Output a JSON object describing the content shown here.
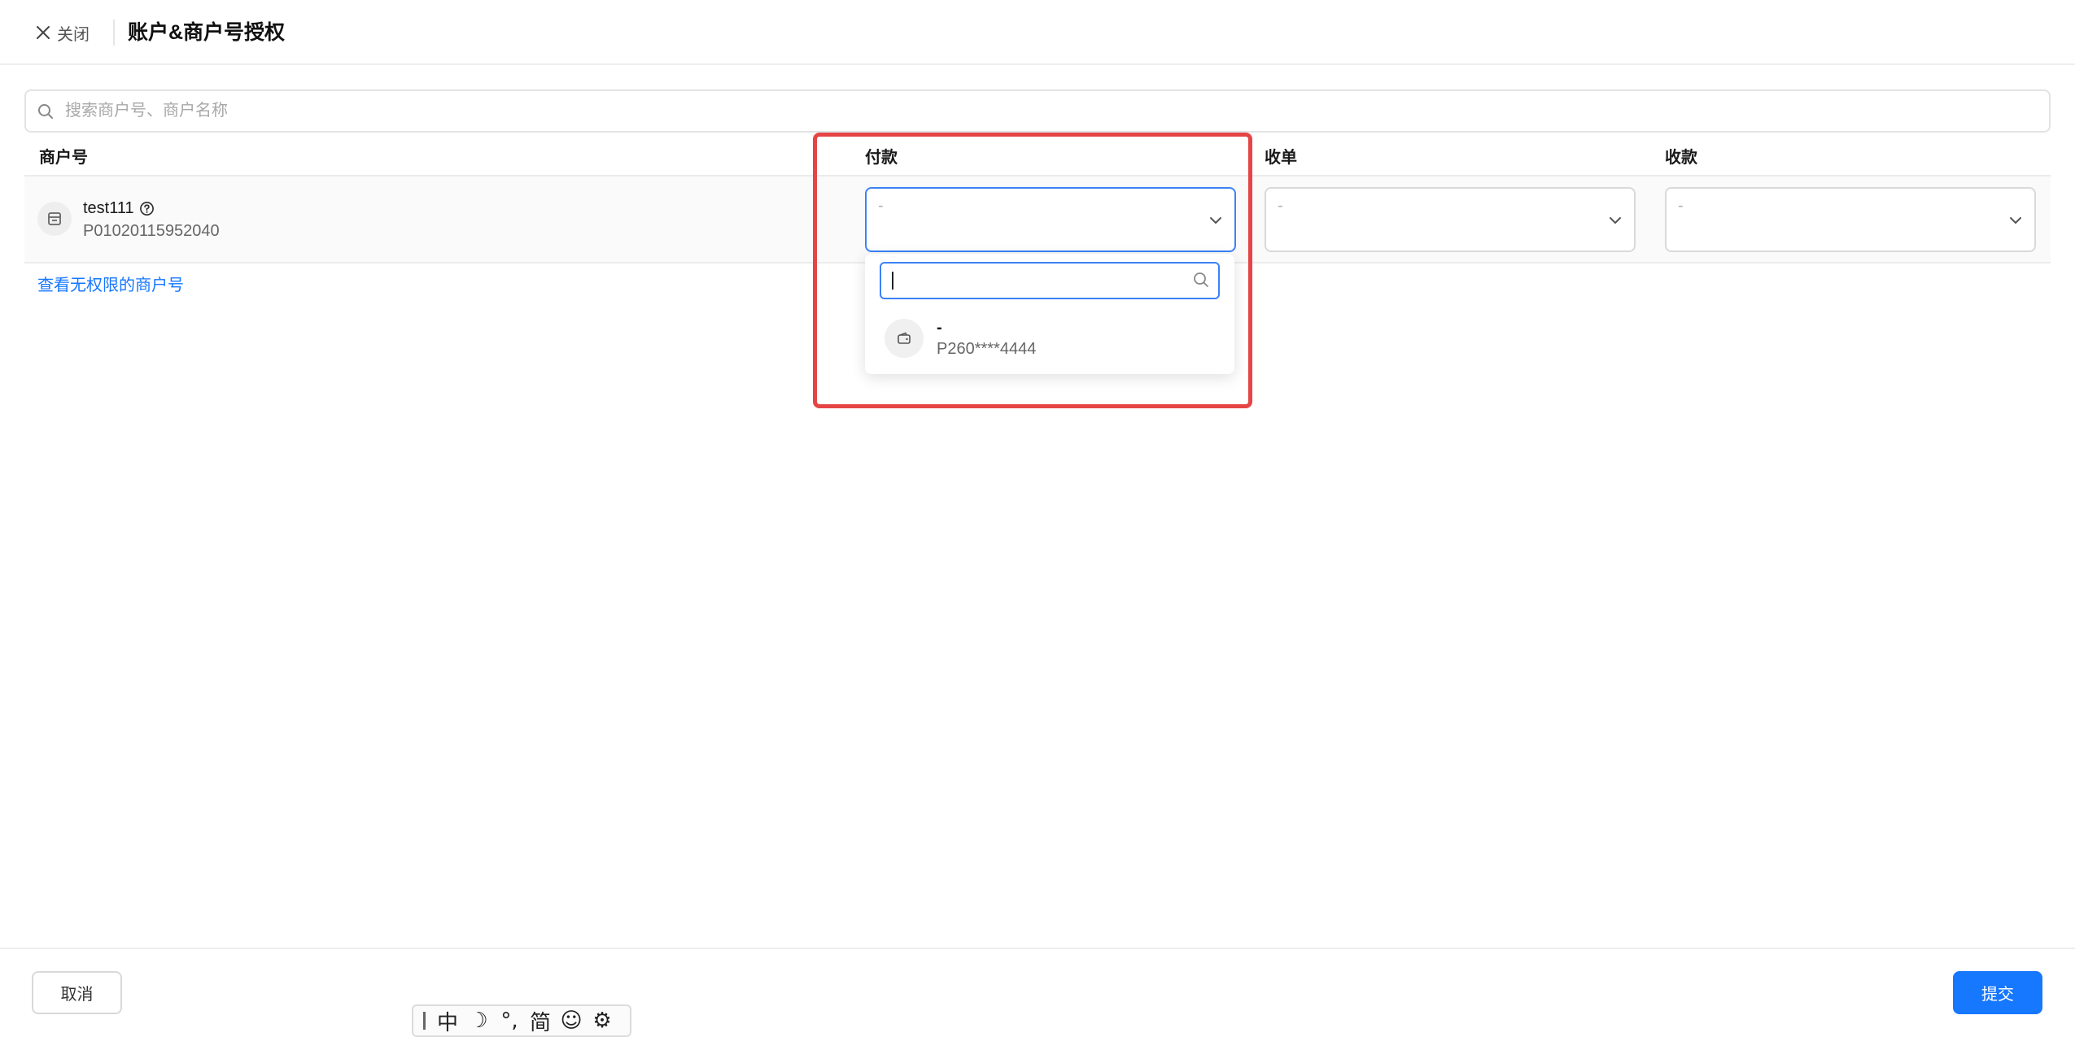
{
  "header": {
    "close_label": "关闭",
    "title": "账户&商户号授权"
  },
  "search": {
    "placeholder": "搜索商户号、商户名称"
  },
  "table": {
    "columns": [
      "商户号",
      "付款",
      "收单",
      "收款"
    ],
    "row": {
      "name": "test111",
      "merchant_id": "P01020115952040",
      "pay_value": "-",
      "acquire_value": "-",
      "receive_value": "-"
    }
  },
  "link": {
    "unlimited": "查看无权限的商户号"
  },
  "dropdown": {
    "search_value": "",
    "option": {
      "name": "-",
      "account": "P260****4444"
    }
  },
  "footer": {
    "cancel_label": "取消",
    "submit_label": "提交"
  },
  "ime": {
    "buttons": [
      "中",
      "☽",
      "°,",
      "简",
      "☺",
      "⚙"
    ]
  },
  "colors": {
    "accent": "#1677ff",
    "focus_border": "#3b82f6",
    "highlight": "#e64545"
  }
}
